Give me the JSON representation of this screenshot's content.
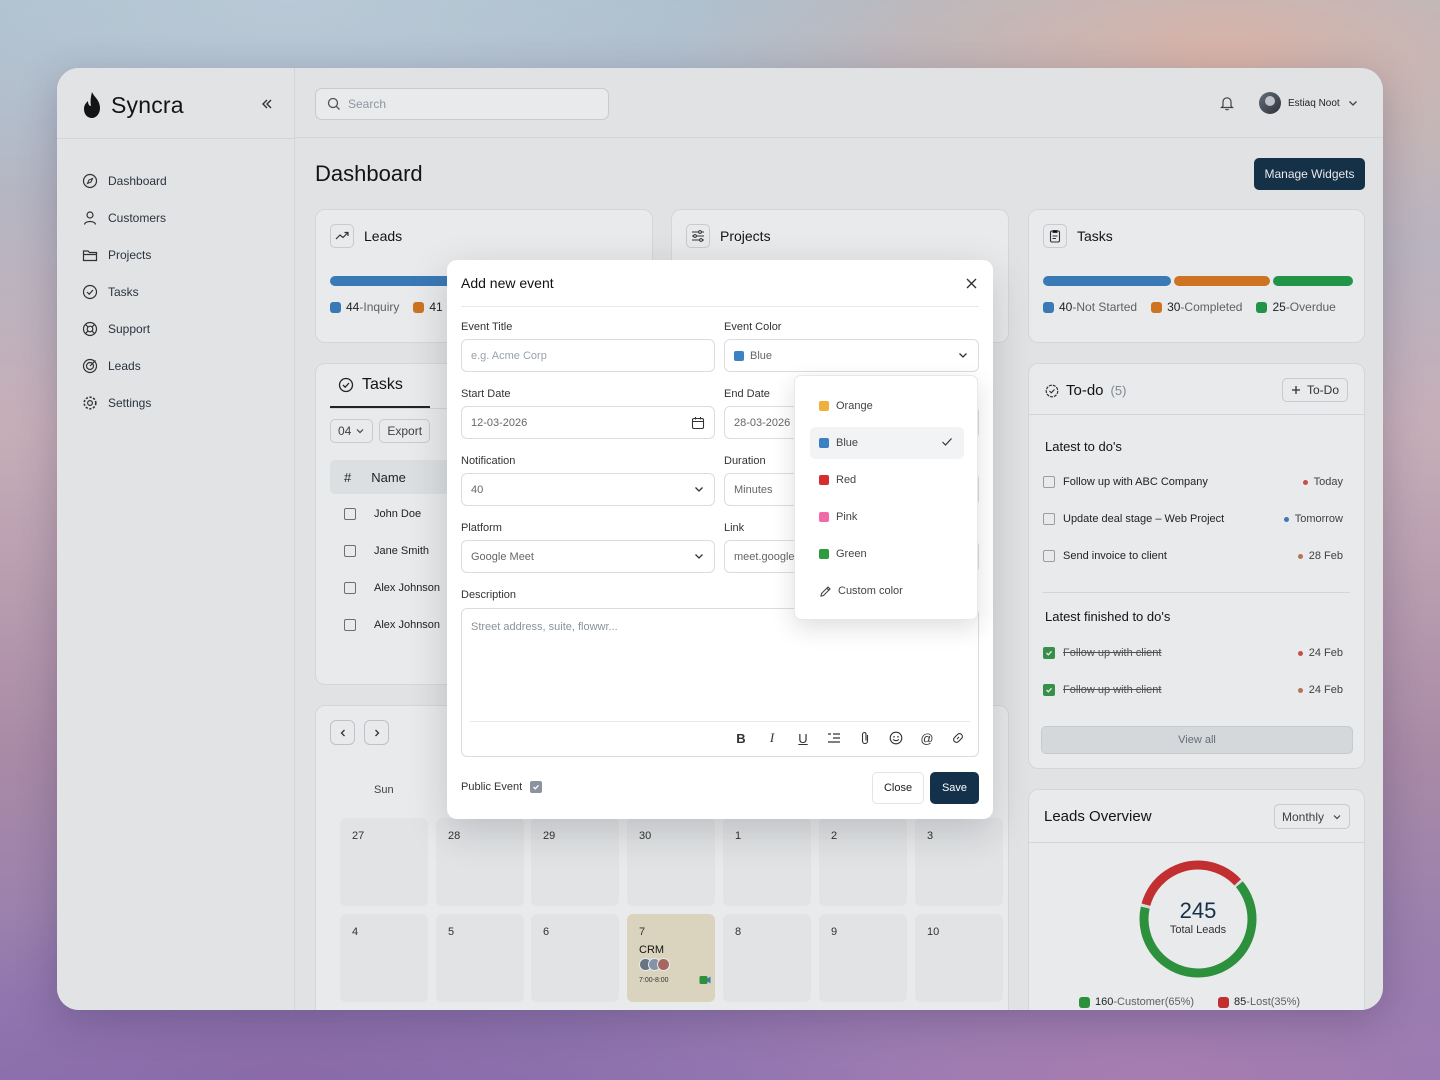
{
  "app": {
    "name": "Syncra"
  },
  "search": {
    "placeholder": "Search"
  },
  "user": {
    "name": "Estiaq Noot"
  },
  "sidebar": {
    "items": [
      {
        "label": "Dashboard",
        "icon": "compass-icon"
      },
      {
        "label": "Customers",
        "icon": "user-icon"
      },
      {
        "label": "Projects",
        "icon": "folder-icon"
      },
      {
        "label": "Tasks",
        "icon": "check-circle-icon"
      },
      {
        "label": "Support",
        "icon": "lifebuoy-icon"
      },
      {
        "label": "Leads",
        "icon": "target-icon"
      },
      {
        "label": "Settings",
        "icon": "gear-icon"
      }
    ]
  },
  "page": {
    "title": "Dashboard",
    "manage_widgets": "Manage Widgets"
  },
  "leads_card": {
    "title": "Leads",
    "legend": [
      {
        "count": "44",
        "label": "-Inquiry"
      },
      {
        "count": "41",
        "label": ""
      }
    ]
  },
  "projects_card": {
    "title": "Projects"
  },
  "tasks_card": {
    "title": "Tasks",
    "legend": [
      {
        "count": "40",
        "label": "-Not Started",
        "color": "#3b82c4"
      },
      {
        "count": "30",
        "label": "-Completed",
        "color": "#e07b1f"
      },
      {
        "count": "25",
        "label": "-Overdue",
        "color": "#22a04a"
      }
    ]
  },
  "tasks_table": {
    "tab": "Tasks",
    "page_size": "04",
    "export": "Export",
    "headers": {
      "num": "#",
      "name": "Name"
    },
    "rows": [
      "John Doe",
      "Jane Smith",
      "Alex Johnson",
      "Alex Johnson"
    ]
  },
  "todo": {
    "title": "To-do",
    "count": "(5)",
    "add_label": "To-Do",
    "latest_title": "Latest to do's",
    "latest": [
      {
        "text": "Follow up with ABC Company",
        "due": "Today",
        "color": "#d9534f"
      },
      {
        "text": "Update deal stage – Web Project",
        "due": "Tomorrow",
        "color": "#3b82c4"
      },
      {
        "text": "Send invoice to client",
        "due": "28 Feb",
        "color": "#c97a5b"
      }
    ],
    "finished_title": "Latest finished to do's",
    "finished": [
      {
        "text": "Follow up with client",
        "due": "24 Feb",
        "color": "#d9534f"
      },
      {
        "text": "Follow up with client",
        "due": "24 Feb",
        "color": "#c97a5b"
      }
    ],
    "view_all": "View all"
  },
  "leads_overview": {
    "title": "Leads Overview",
    "period": "Monthly",
    "total": "245",
    "total_label": "Total Leads",
    "legend": [
      {
        "count": "160",
        "label": "-Customer(65%)",
        "color": "#2e9b3e"
      },
      {
        "count": "85",
        "label": "-Lost(35%)",
        "color": "#d32f2f"
      }
    ]
  },
  "chart_data": {
    "type": "pie",
    "categories": [
      "Customer",
      "Lost"
    ],
    "values": [
      160,
      85
    ],
    "total": 245
  },
  "calendar": {
    "weekday": "Sun",
    "row1": [
      "27",
      "28",
      "29",
      "30",
      "1",
      "2",
      "3"
    ],
    "row2": [
      "4",
      "5",
      "6",
      "7",
      "8",
      "9",
      "10"
    ],
    "event": {
      "title": "CRM",
      "time": "7:00-8:00"
    }
  },
  "modal": {
    "title": "Add new event",
    "event_title_label": "Event Title",
    "event_title_placeholder": "e.g. Acme Corp",
    "event_color_label": "Event Color",
    "event_color_value": "Blue",
    "start_date_label": "Start Date",
    "start_date_value": "12-03-2026",
    "end_date_label": "End Date",
    "end_date_value": "28-03-2026",
    "notification_label": "Notification",
    "notification_value": "40",
    "duration_label": "Duration",
    "duration_value": "Minutes",
    "platform_label": "Platform",
    "platform_value": "Google Meet",
    "link_label": "Link",
    "link_value": "meet.google",
    "description_label": "Description",
    "description_placeholder": "Street address, suite, flowwr...",
    "public_label": "Public Event",
    "close": "Close",
    "save": "Save"
  },
  "color_options": [
    {
      "label": "Orange",
      "color": "#f0b03c"
    },
    {
      "label": "Blue",
      "color": "#3b82c4",
      "selected": true
    },
    {
      "label": "Red",
      "color": "#d32f2f"
    },
    {
      "label": "Pink",
      "color": "#f06aa8"
    },
    {
      "label": "Green",
      "color": "#2e9b3e"
    },
    {
      "label": "Custom color",
      "icon": "pencil-icon"
    }
  ]
}
